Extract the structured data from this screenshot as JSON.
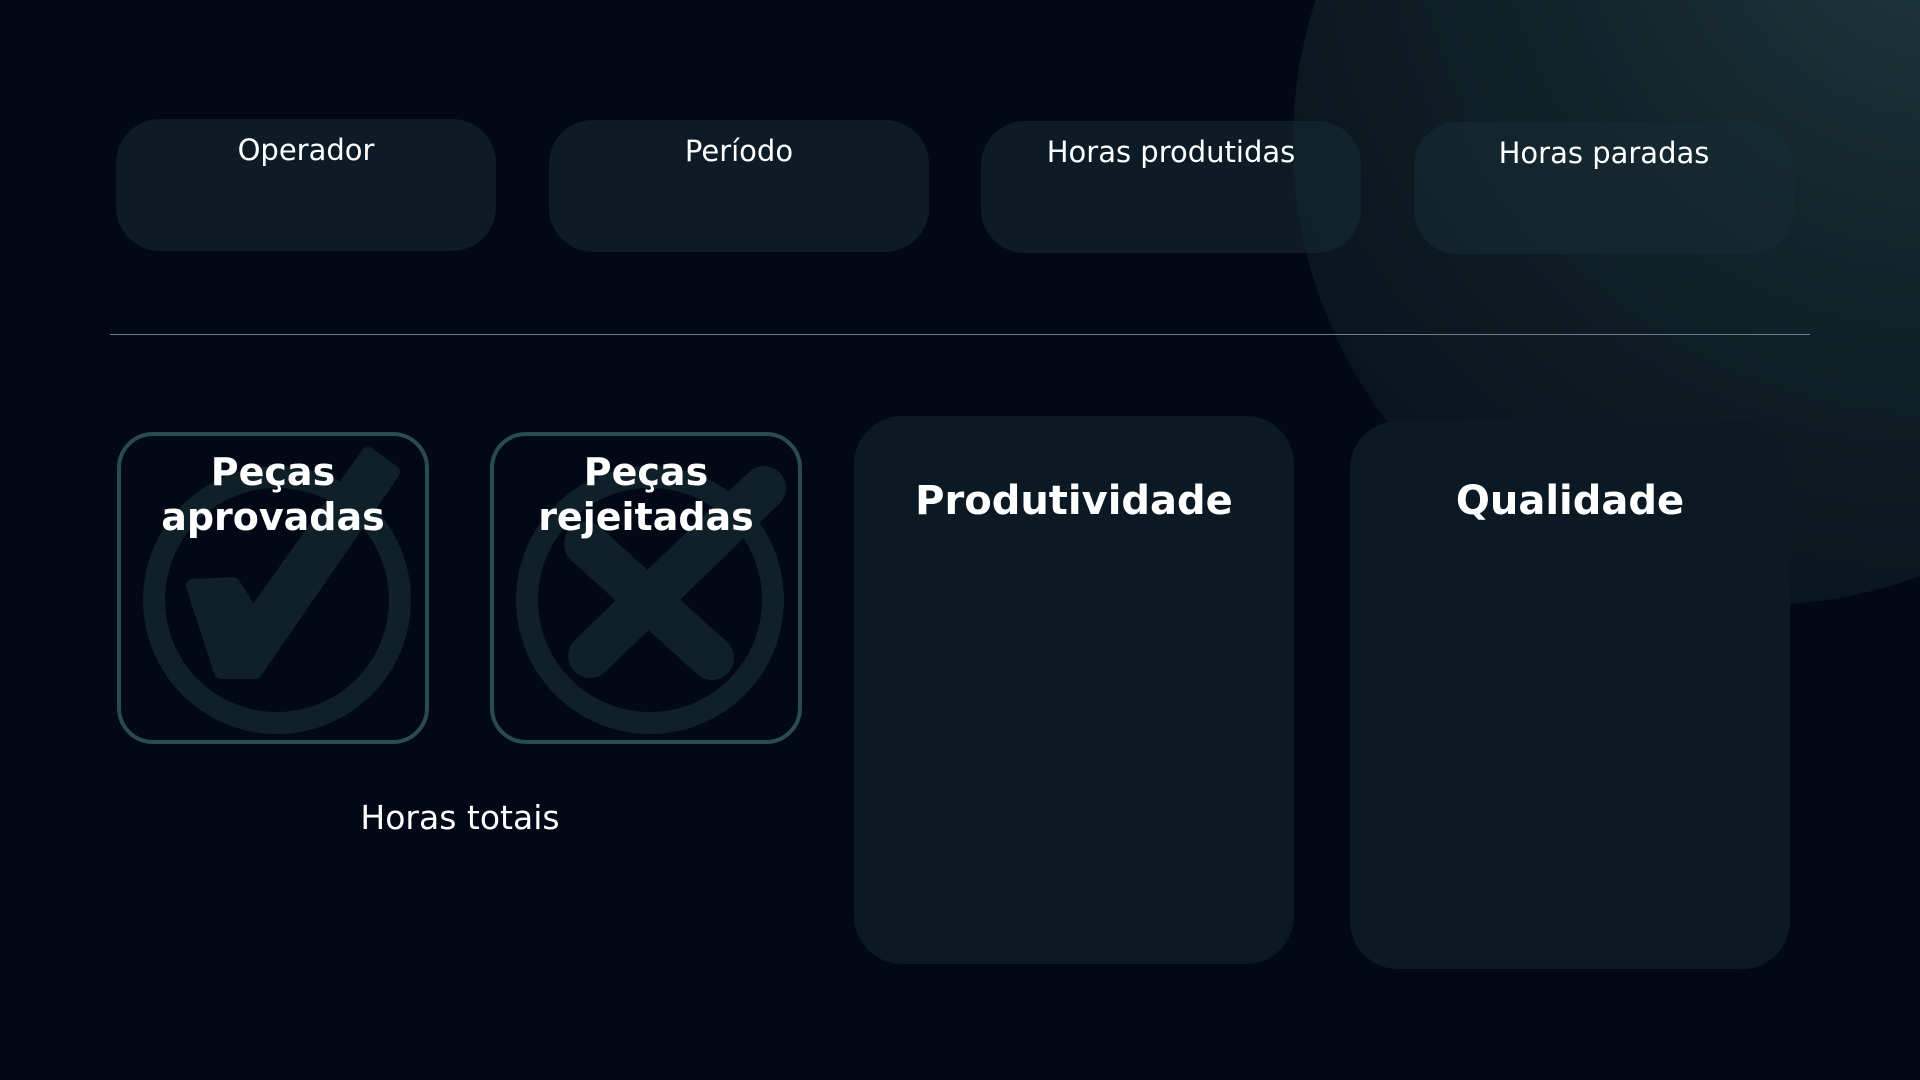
{
  "filters": {
    "operador": "Operador",
    "periodo": "Período",
    "horas_produtidas": "Horas produtidas",
    "horas_paradas": "Horas paradas"
  },
  "cards": {
    "pecas_aprovadas_line1": "Peças",
    "pecas_aprovadas_line2": "aprovadas",
    "pecas_rejeitadas_line1": "Peças",
    "pecas_rejeitadas_line2": "rejeitadas"
  },
  "horas_totais": "Horas totais",
  "metrics": {
    "produtividade": "Produtividade",
    "qualidade": "Qualidade"
  },
  "icons": {
    "approved": "check-circle-icon",
    "rejected": "x-circle-icon"
  },
  "colors": {
    "background": "#020816",
    "card": "#0b1924",
    "card_border": "#2a4a52",
    "icon_watermark": "#0f2028"
  }
}
